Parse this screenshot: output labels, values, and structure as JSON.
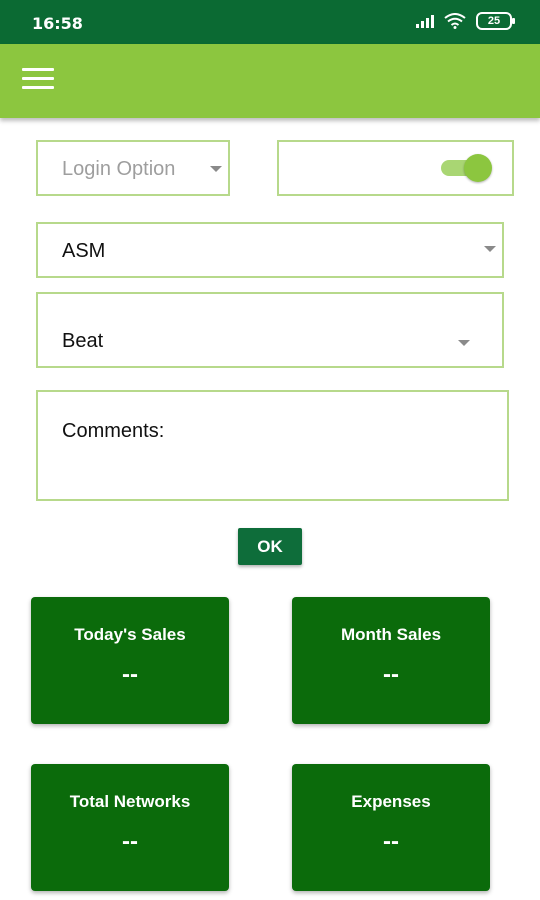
{
  "status_bar": {
    "time": "16:58",
    "battery": "25"
  },
  "form": {
    "login_option": {
      "label": "Login Option",
      "caret_icon": "caret-down-icon"
    },
    "toggle": {
      "state": "on"
    },
    "asm": {
      "value": "ASM",
      "caret_icon": "caret-down-icon"
    },
    "beat": {
      "value": "Beat",
      "caret_icon": "caret-down-icon"
    },
    "comments": {
      "label": "Comments:"
    },
    "ok_label": "OK"
  },
  "cards": [
    {
      "title": "Today's Sales",
      "value": "--"
    },
    {
      "title": "Month Sales",
      "value": "--"
    },
    {
      "title": "Total Networks",
      "value": "--"
    },
    {
      "title": "Expenses",
      "value": "--"
    }
  ],
  "colors": {
    "status_bar": "#0b6a33",
    "app_bar": "#8cc63f",
    "field_border": "#b7d98b",
    "ok_button": "#0e6d3a",
    "card": "#0b6b0b"
  }
}
